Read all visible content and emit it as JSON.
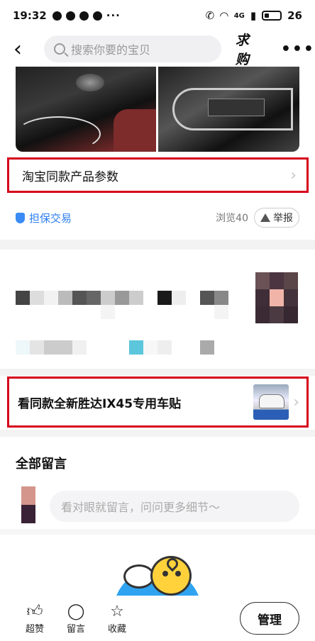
{
  "status_bar": {
    "time": "19:32",
    "more": "···",
    "signal": "4G",
    "battery": "26"
  },
  "nav": {
    "back_icon": "chevron-left-icon",
    "search_placeholder": "搜索你要的宝贝",
    "qiugou": "求购",
    "more": "•••"
  },
  "product": {
    "params_label": "淘宝同款产品参数",
    "guarantee_label": "担保交易",
    "views": "浏览40",
    "report_label": "举报"
  },
  "same_model": {
    "label": "看同款全新胜达IX45专用车贴"
  },
  "comments": {
    "title": "全部留言",
    "input_placeholder": "看对眼就留言，问问更多细节～"
  },
  "bottom_bar": {
    "like": "超赞",
    "comment": "留言",
    "favorite": "收藏",
    "manage": "管理"
  },
  "colors": {
    "highlight_border": "#d6001c",
    "link_blue": "#2b7ef0"
  }
}
